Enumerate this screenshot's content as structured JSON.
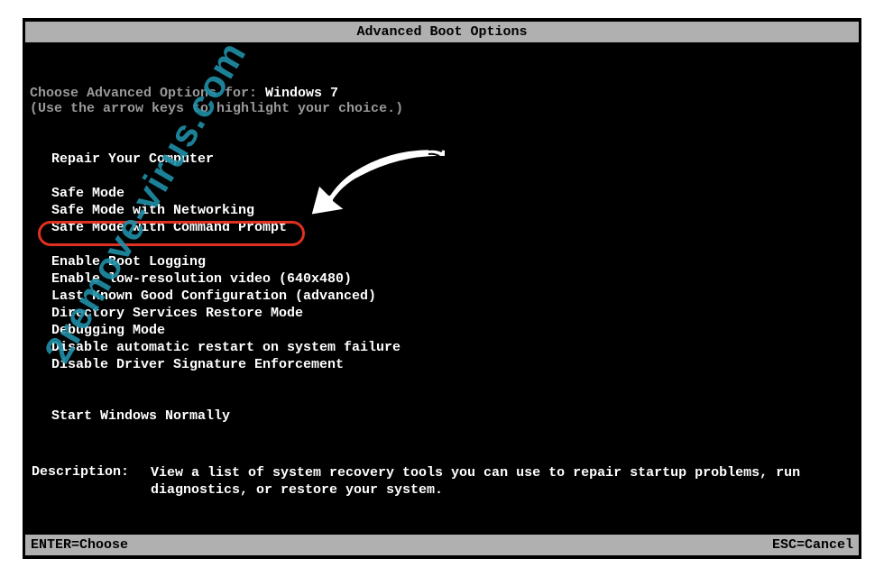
{
  "title": "Advanced Boot Options",
  "prompt": {
    "prefix": "Choose Advanced Options for: ",
    "os": "Windows 7",
    "hint": "(Use the arrow keys to highlight your choice.)"
  },
  "menu": {
    "group1": [
      "Repair Your Computer"
    ],
    "group2": [
      "Safe Mode",
      "Safe Mode with Networking",
      "Safe Mode with Command Prompt"
    ],
    "group3": [
      "Enable Boot Logging",
      "Enable low-resolution video (640x480)",
      "Last Known Good Configuration (advanced)",
      "Directory Services Restore Mode",
      "Debugging Mode",
      "Disable automatic restart on system failure",
      "Disable Driver Signature Enforcement"
    ],
    "group4": [
      "Start Windows Normally"
    ]
  },
  "description": {
    "label": "Description:",
    "text": "View a list of system recovery tools you can use to repair startup problems, run diagnostics, or restore your system."
  },
  "footer": {
    "left": "ENTER=Choose",
    "right": "ESC=Cancel"
  },
  "annotation": {
    "highlighted_item": "Safe Mode with Command Prompt",
    "watermark": "2remove-virus.com"
  }
}
